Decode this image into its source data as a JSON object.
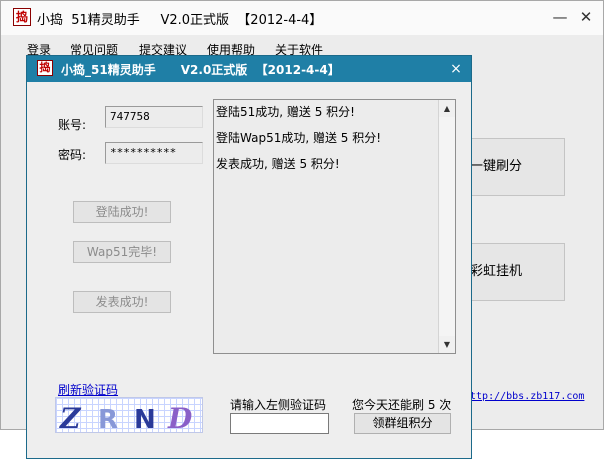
{
  "main_window": {
    "logo": "捣",
    "title": "小捣  51精灵助手     V2.0正式版  【2012-4-4】",
    "minimize": "—",
    "close": "✕",
    "menu": [
      "登录",
      "常见问题",
      "提交建议",
      "使用帮助",
      "关于软件"
    ],
    "buttons": {
      "one_click": "一键刷分",
      "rainbow": "彩虹挂机"
    },
    "link": "http://bbs.zb117.com"
  },
  "dialog": {
    "logo": "捣",
    "title": "小捣_51精灵助手      V2.0正式版  【2012-4-4】",
    "close": "×",
    "account_label": "账号:",
    "account_value": "747758",
    "password_label": "密码:",
    "password_value": "**********",
    "status_buttons": [
      "登陆成功!",
      "Wap51完毕!",
      "发表成功!"
    ],
    "log": [
      "登陆51成功, 赠送 5 积分!",
      "登陆Wap51成功, 赠送 5 积分!",
      "发表成功, 赠送 5 积分!"
    ],
    "scroll_up": "▲",
    "scroll_down": "▼",
    "refresh_captcha": "刷新验证码",
    "captcha_text": "ZRND",
    "code_prompt": "请输入左侧验证码",
    "code_value": "",
    "remaining": "您今天还能刷 5 次",
    "claim_button": "领群组积分"
  }
}
